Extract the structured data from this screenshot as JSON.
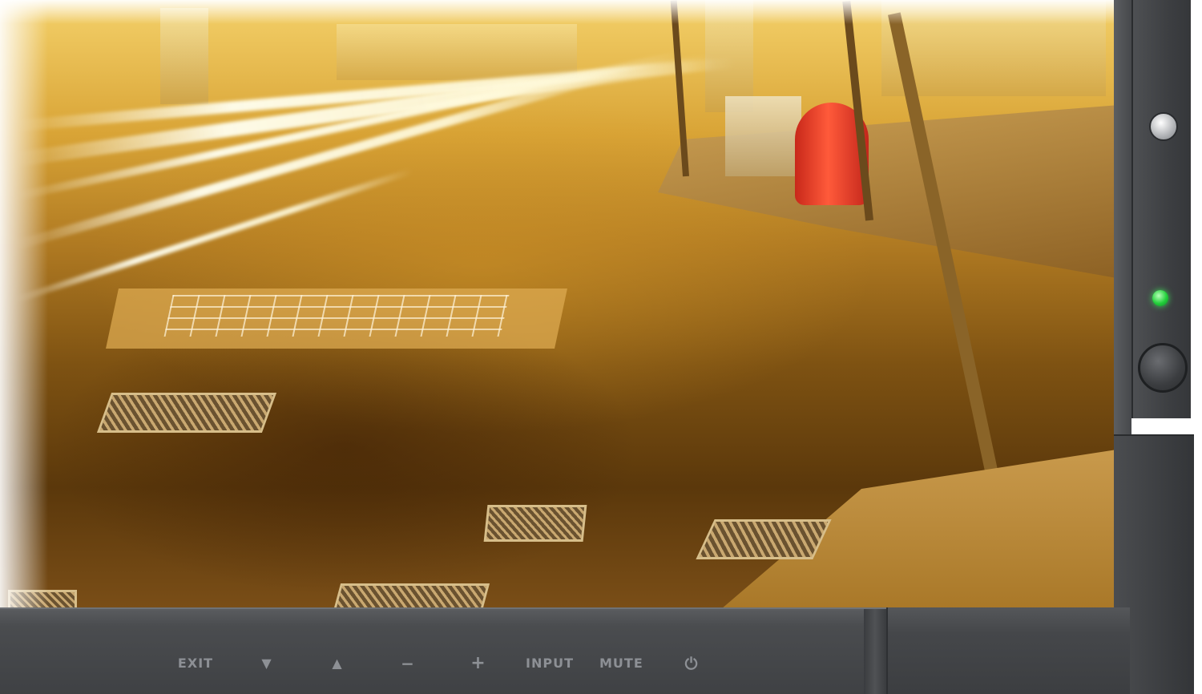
{
  "monitor": {
    "bezel_color": "#4a4c4f",
    "led_color": "#22d03a",
    "controls": [
      {
        "id": "exit",
        "label": "EXIT",
        "icon": "exit-label"
      },
      {
        "id": "down",
        "label": "▼",
        "icon": "triangle-down-icon"
      },
      {
        "id": "up",
        "label": "▲",
        "icon": "triangle-up-icon"
      },
      {
        "id": "minus",
        "label": "−",
        "icon": "minus-icon"
      },
      {
        "id": "plus",
        "label": "+",
        "icon": "plus-icon"
      },
      {
        "id": "input",
        "label": "INPUT",
        "icon": "input-label"
      },
      {
        "id": "mute",
        "label": "MUTE",
        "icon": "mute-label"
      },
      {
        "id": "power",
        "label": "⏻",
        "icon": "power-icon"
      }
    ]
  }
}
